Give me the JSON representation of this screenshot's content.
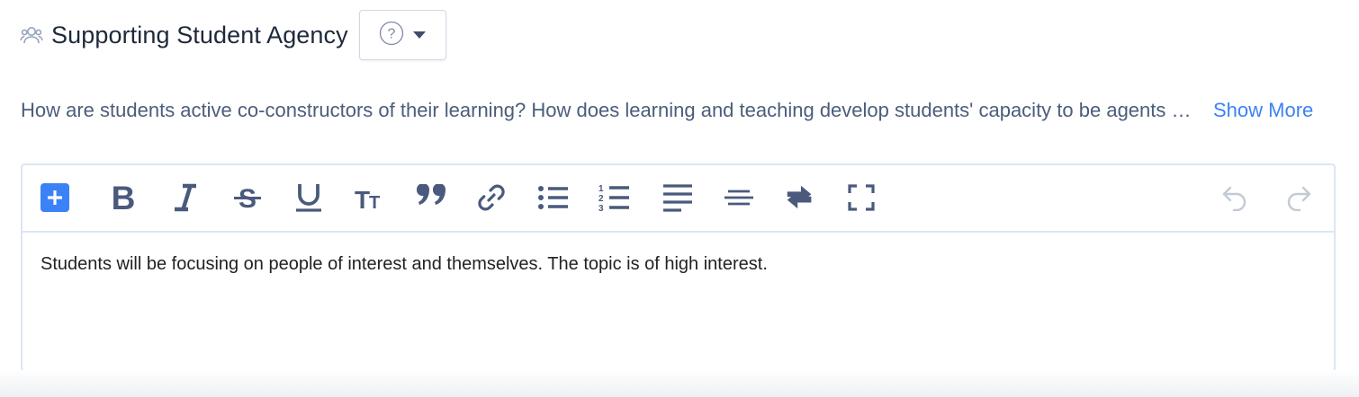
{
  "header": {
    "icon": "people-icon",
    "title": "Supporting Student Agency",
    "help_dropdown": {
      "icon": "question-circle-icon",
      "caret": "caret-down-icon"
    }
  },
  "description": {
    "text": "How are students active co-constructors of their learning? How does learning and teaching develop students' capacity to be agents of their own learning?",
    "show_more_label": "Show More"
  },
  "editor": {
    "toolbar": [
      "add-block-icon",
      "bold-icon",
      "italic-icon",
      "strikethrough-icon",
      "underline-icon",
      "text-size-icon",
      "blockquote-icon",
      "link-icon",
      "bullet-list-icon",
      "numbered-list-icon",
      "align-left-icon",
      "align-center-icon",
      "clear-format-icon",
      "fullscreen-icon",
      "undo-icon",
      "redo-icon"
    ],
    "content": "Students will be focusing on people of interest and themselves. The topic is of high interest."
  },
  "colors": {
    "accent": "#3b82f6",
    "toolbar_icon": "#4a5a7c",
    "disabled_icon": "#c3cad6",
    "border": "#dbe6f4",
    "title": "#1e293b",
    "description": "#4b5d7a"
  }
}
